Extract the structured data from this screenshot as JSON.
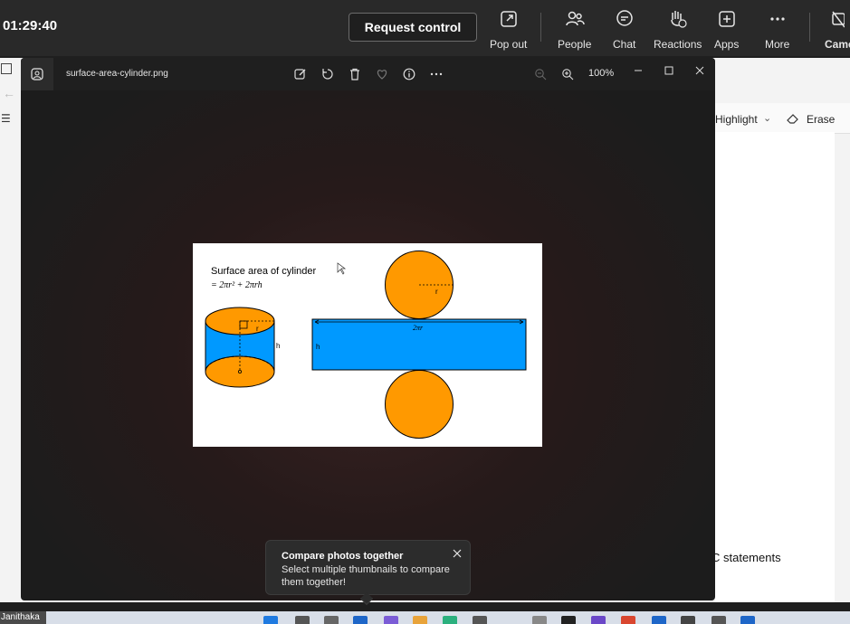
{
  "meeting": {
    "timer": "01:29:40",
    "request_control": "Request control",
    "tools": [
      {
        "label": "Pop out",
        "icon": "pop-out-icon"
      },
      {
        "label": "People",
        "icon": "people-icon"
      },
      {
        "label": "Chat",
        "icon": "chat-icon"
      },
      {
        "label": "Reactions",
        "icon": "reactions-icon"
      },
      {
        "label": "Apps",
        "icon": "apps-icon"
      },
      {
        "label": "More",
        "icon": "more-icon"
      },
      {
        "label": "Came",
        "icon": "camera-off-icon"
      }
    ]
  },
  "background_window": {
    "highlight": "Highlight",
    "erase": "Erase",
    "statements": "C statements"
  },
  "viewer": {
    "filename": "surface-area-cylinder.png",
    "zoom": "100%",
    "toolbar_icons": [
      "edit-icon",
      "rotate-icon",
      "delete-icon",
      "favorite-icon",
      "info-icon",
      "more-options-icon"
    ]
  },
  "image": {
    "title": "Surface area of cylinder",
    "formula": "= 2πr² + 2πrh",
    "label_r_top": "r",
    "label_r_cyl": "r",
    "label_h_cyl": "h",
    "label_h_rect": "h",
    "label_circumference": "2πr",
    "colors": {
      "orange": "#FF9900",
      "blue": "#0099FF"
    }
  },
  "toast": {
    "title": "Compare photos together",
    "body": "Select multiple thumbnails to compare them together!"
  },
  "taskbar": {
    "user": "Janithaka"
  }
}
